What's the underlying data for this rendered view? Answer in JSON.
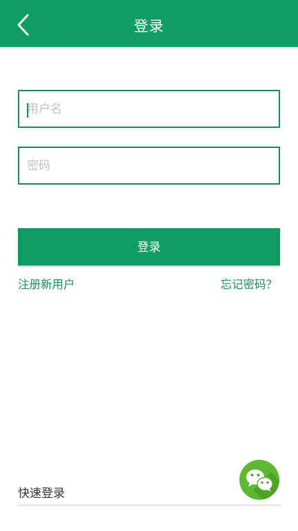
{
  "header": {
    "title": "登录",
    "background": "#0f9d63"
  },
  "form": {
    "username_placeholder": "用户名",
    "password_placeholder": "密码",
    "username_value": "",
    "password_value": "",
    "login_label": "登录"
  },
  "links": {
    "register": "注册新用户",
    "forgot": "忘记密码？"
  },
  "quick_login": {
    "label": "快速登录",
    "icon": "wechat-icon"
  },
  "colors": {
    "accent": "#0f9d63",
    "border": "#1e8a5e",
    "link": "#17925f",
    "wechat": "#5fb831"
  }
}
